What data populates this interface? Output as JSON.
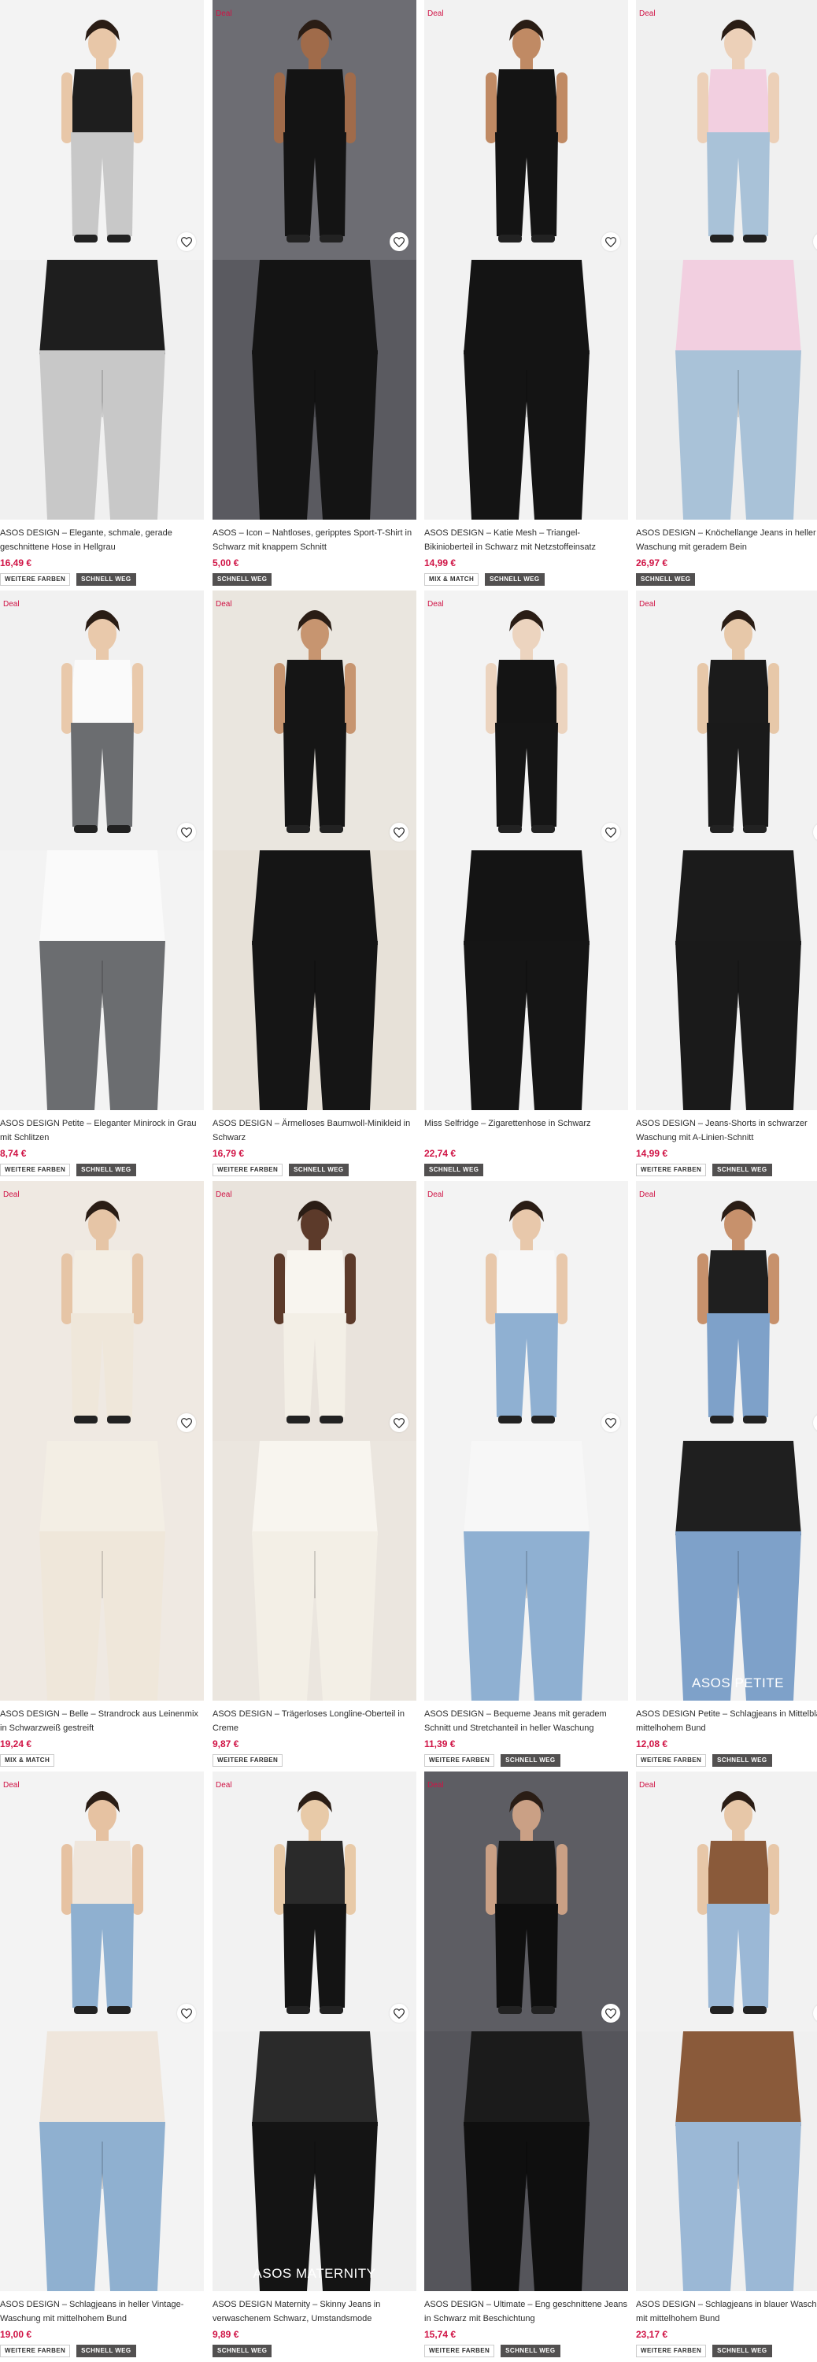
{
  "colors": {
    "price": "#d01345",
    "deal": "#d01345",
    "tag_dark": "#525050"
  },
  "products": [
    {
      "deal": "",
      "title": "ASOS DESIGN – Elegante, schmale, gerade geschnittene Hose in Hellgrau",
      "price": "16,49 €",
      "tags": [
        "WEITERE FARBEN",
        "SCHNELL WEG"
      ],
      "overlay": "",
      "icon": "heart-icon"
    },
    {
      "deal": "Deal",
      "title": "ASOS – Icon – Nahtloses, geripptes Sport-T-Shirt in Schwarz mit knappem Schnitt",
      "price": "5,00 €",
      "tags": [
        "SCHNELL WEG"
      ],
      "overlay": "",
      "icon": "heart-icon"
    },
    {
      "deal": "Deal",
      "title": "ASOS DESIGN – Katie Mesh – Triangel-Bikinioberteil in Schwarz mit Netzstoffeinsatz",
      "price": "14,99 €",
      "tags": [
        "MIX & MATCH",
        "SCHNELL WEG"
      ],
      "overlay": "",
      "icon": "heart-icon"
    },
    {
      "deal": "Deal",
      "title": "ASOS DESIGN – Knöchellange Jeans in heller Waschung mit geradem Bein",
      "price": "26,97 €",
      "tags": [
        "SCHNELL WEG"
      ],
      "overlay": "",
      "icon": "heart-icon"
    },
    {
      "deal": "Deal",
      "title": "ASOS DESIGN Petite – Eleganter Minirock in Grau mit Schlitzen",
      "price": "8,74 €",
      "tags": [
        "WEITERE FARBEN",
        "SCHNELL WEG"
      ],
      "overlay": "",
      "icon": "heart-icon"
    },
    {
      "deal": "Deal",
      "title": "ASOS DESIGN – Ärmelloses Baumwoll-Minikleid in Schwarz",
      "price": "16,79 €",
      "tags": [
        "WEITERE FARBEN",
        "SCHNELL WEG"
      ],
      "overlay": "",
      "icon": "heart-icon"
    },
    {
      "deal": "Deal",
      "title": "Miss Selfridge – Zigarettenhose in Schwarz",
      "price": "22,74 €",
      "tags": [
        "SCHNELL WEG"
      ],
      "overlay": "",
      "icon": "heart-icon"
    },
    {
      "deal": "Deal",
      "title": "ASOS DESIGN – Jeans-Shorts in schwarzer Waschung mit A-Linien-Schnitt",
      "price": "14,99 €",
      "tags": [
        "WEITERE FARBEN",
        "SCHNELL WEG"
      ],
      "overlay": "",
      "icon": "heart-icon"
    },
    {
      "deal": "Deal",
      "title": "ASOS DESIGN – Belle – Strandrock aus Leinenmix in Schwarzweiß gestreift",
      "price": "19,24 €",
      "tags": [
        "MIX & MATCH"
      ],
      "overlay": "",
      "icon": "heart-icon"
    },
    {
      "deal": "Deal",
      "title": "ASOS DESIGN – Trägerloses Longline-Oberteil in Creme",
      "price": "9,87 €",
      "tags": [
        "WEITERE FARBEN"
      ],
      "overlay": "",
      "icon": "heart-icon"
    },
    {
      "deal": "Deal",
      "title": "ASOS DESIGN – Bequeme Jeans mit geradem Schnitt und Stretchanteil in heller Waschung",
      "price": "11,39 €",
      "tags": [
        "WEITERE FARBEN",
        "SCHNELL WEG"
      ],
      "overlay": "",
      "icon": "heart-icon"
    },
    {
      "deal": "Deal",
      "title": "ASOS DESIGN Petite – Schlagjeans in Mittelblau mit mittelhohem Bund",
      "price": "12,08 €",
      "tags": [
        "WEITERE FARBEN",
        "SCHNELL WEG"
      ],
      "overlay": "ASOS PETITE",
      "icon": "heart-icon"
    },
    {
      "deal": "Deal",
      "title": "ASOS DESIGN – Schlagjeans in heller Vintage-Waschung mit mittelhohem Bund",
      "price": "19,00 €",
      "tags": [
        "WEITERE FARBEN",
        "SCHNELL WEG"
      ],
      "overlay": "",
      "icon": "heart-icon"
    },
    {
      "deal": "Deal",
      "title": "ASOS DESIGN Maternity – Skinny Jeans in verwaschenem Schwarz, Umstandsmode",
      "price": "9,89 €",
      "tags": [
        "SCHNELL WEG"
      ],
      "overlay": "ASOS MATERNITY",
      "icon": "heart-icon"
    },
    {
      "deal": "Deal",
      "title": "ASOS DESIGN – Ultimate – Eng geschnittene Jeans in Schwarz mit Beschichtung",
      "price": "15,74 €",
      "tags": [
        "WEITERE FARBEN",
        "SCHNELL WEG"
      ],
      "overlay": "",
      "icon": "heart-icon"
    },
    {
      "deal": "Deal",
      "title": "ASOS DESIGN – Schlagjeans in blauer Waschung mit mittelhohem Bund",
      "price": "23,17 €",
      "tags": [
        "WEITERE FARBEN",
        "SCHNELL WEG"
      ],
      "overlay": "",
      "icon": "heart-icon"
    }
  ]
}
